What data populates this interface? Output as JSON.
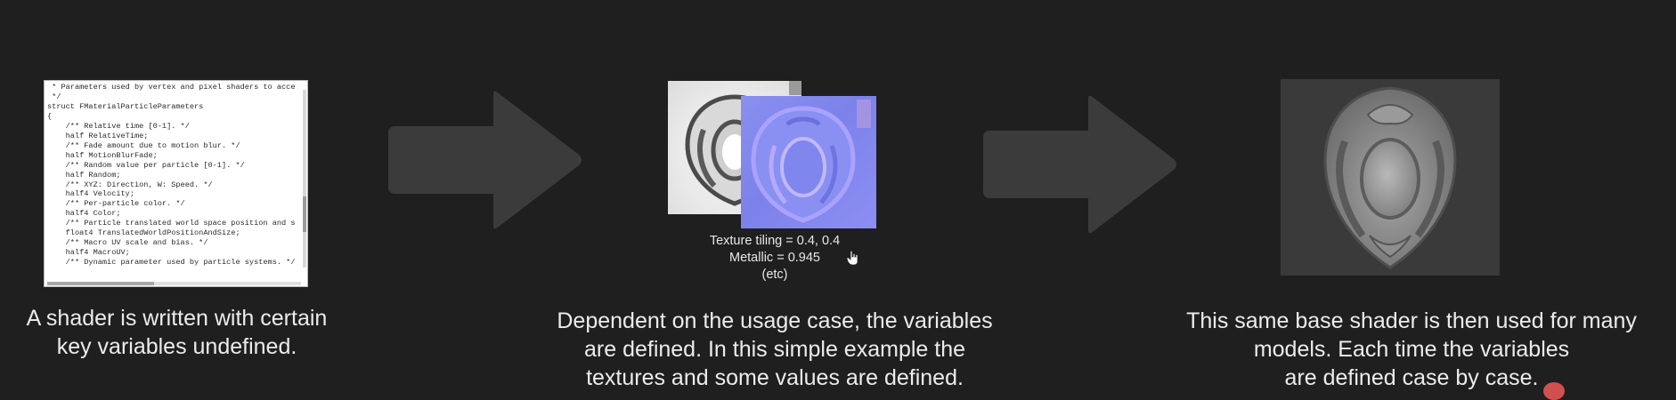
{
  "step1": {
    "code_lines": [
      " * Parameters used by vertex and pixel shaders to acce",
      " */",
      "struct FMaterialParticleParameters",
      "{",
      "    /** Relative time [0-1]. */",
      "    half RelativeTime;",
      "    /** Fade amount due to motion blur. */",
      "    half MotionBlurFade;",
      "    /** Random value per particle [0-1]. */",
      "    half Random;",
      "    /** XYZ: Direction, W: Speed. */",
      "    half4 Velocity;",
      "    /** Per-particle color. */",
      "    half4 Color;",
      "    /** Particle translated world space position and s",
      "    float4 TranslatedWorldPositionAndSize;",
      "    /** Macro UV scale and bias. */",
      "    half4 MacroUV;",
      "    /** Dynamic parameter used by particle systems. */"
    ],
    "caption_lines": [
      "A shader is written with certain",
      "key variables undefined."
    ]
  },
  "step2": {
    "texture_info": [
      "Texture tiling = 0.4, 0.4",
      "Metallic = 0.945",
      "(etc)"
    ],
    "caption_lines": [
      "Dependent on the usage case, the variables",
      "are defined. In this simple example the",
      "textures and some values are defined."
    ]
  },
  "step3": {
    "caption_lines": [
      "This same base shader is then used for many",
      "models. Each time the variables",
      "are defined case by case."
    ]
  },
  "colors": {
    "background": "#1f1f1f",
    "arrow": "#3b3b3b",
    "caption_text": "#ececec",
    "normal_map": "#7c82ea",
    "render_bg": "#3a3a3a"
  },
  "icons": [
    "arrow-right-icon",
    "hand-cursor-icon"
  ]
}
